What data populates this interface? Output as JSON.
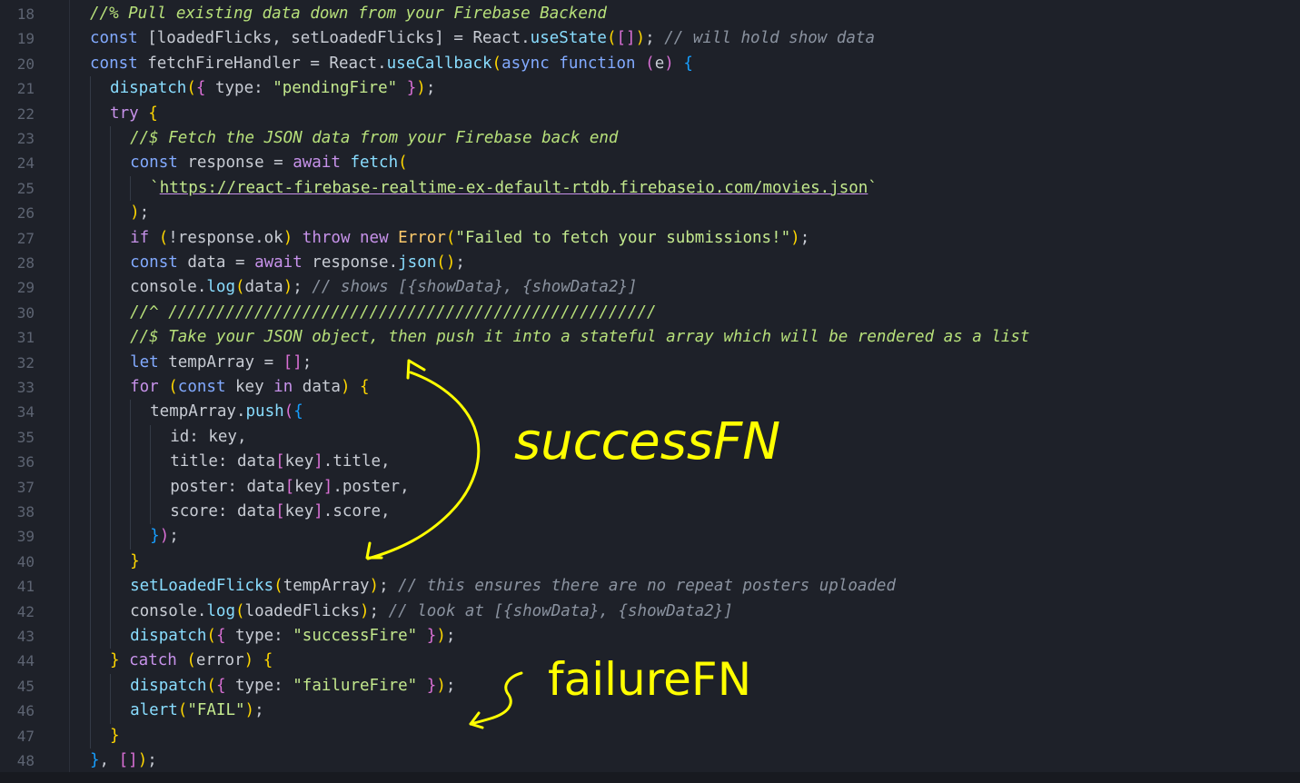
{
  "editor": {
    "first_line_number": 18,
    "lines": [
      {
        "n": "18",
        "indent": 0,
        "tokens": [
          [
            "//% Pull existing data down from your Firebase Backend",
            "hl"
          ]
        ]
      },
      {
        "n": "19",
        "indent": 0,
        "tokens": [
          [
            "const",
            "keyword"
          ],
          [
            " [loadedFlicks, setLoadedFlicks] = React.",
            ""
          ],
          [
            "useState",
            "func"
          ],
          [
            "(",
            "paren"
          ],
          [
            "[]",
            "bracket"
          ],
          [
            ")",
            "paren"
          ],
          [
            "; ",
            ""
          ],
          [
            "// will hold show data",
            "comment"
          ]
        ]
      },
      {
        "n": "20",
        "indent": 0,
        "tokens": [
          [
            "const",
            "keyword"
          ],
          [
            " fetchFireHandler = React.",
            ""
          ],
          [
            "useCallback",
            "func"
          ],
          [
            "(",
            "paren"
          ],
          [
            "async function",
            "keyword"
          ],
          [
            " ",
            ""
          ],
          [
            "(",
            "bracket"
          ],
          [
            "e",
            ""
          ],
          [
            ")",
            "bracket"
          ],
          [
            " ",
            ""
          ],
          [
            "{",
            "brace"
          ]
        ]
      },
      {
        "n": "21",
        "indent": 1,
        "tokens": [
          [
            "dispatch",
            "func"
          ],
          [
            "(",
            "paren"
          ],
          [
            "{",
            "bracket"
          ],
          [
            " type: ",
            ""
          ],
          [
            "\"pendingFire\"",
            "string"
          ],
          [
            " ",
            ""
          ],
          [
            "}",
            "bracket"
          ],
          [
            ")",
            "paren"
          ],
          [
            ";",
            ""
          ]
        ]
      },
      {
        "n": "22",
        "indent": 1,
        "tokens": [
          [
            "try",
            "control"
          ],
          [
            " ",
            ""
          ],
          [
            "{",
            "paren"
          ]
        ]
      },
      {
        "n": "23",
        "indent": 2,
        "tokens": [
          [
            "//$ Fetch the JSON data from your Firebase back end",
            "hl"
          ]
        ]
      },
      {
        "n": "24",
        "indent": 2,
        "tokens": [
          [
            "const",
            "keyword"
          ],
          [
            " response = ",
            ""
          ],
          [
            "await",
            "control"
          ],
          [
            " ",
            ""
          ],
          [
            "fetch",
            "func"
          ],
          [
            "(",
            "paren"
          ]
        ]
      },
      {
        "n": "25",
        "indent": 3,
        "tokens": [
          [
            "`",
            "string"
          ],
          [
            "https://react-firebase-realtime-ex-default-rtdb.firebaseio.com/movies.json",
            "url"
          ],
          [
            "`",
            "string"
          ]
        ]
      },
      {
        "n": "26",
        "indent": 2,
        "tokens": [
          [
            ")",
            "paren"
          ],
          [
            ";",
            ""
          ]
        ]
      },
      {
        "n": "27",
        "indent": 2,
        "tokens": [
          [
            "if",
            "control"
          ],
          [
            " ",
            ""
          ],
          [
            "(",
            "paren"
          ],
          [
            "!response.ok",
            ""
          ],
          [
            ")",
            "paren"
          ],
          [
            " ",
            ""
          ],
          [
            "throw new",
            "control"
          ],
          [
            " ",
            ""
          ],
          [
            "Error",
            "class"
          ],
          [
            "(",
            "paren"
          ],
          [
            "\"Failed to fetch your submissions!\"",
            "string"
          ],
          [
            ")",
            "paren"
          ],
          [
            ";",
            ""
          ]
        ]
      },
      {
        "n": "28",
        "indent": 2,
        "tokens": [
          [
            "const",
            "keyword"
          ],
          [
            " data = ",
            ""
          ],
          [
            "await",
            "control"
          ],
          [
            " response.",
            ""
          ],
          [
            "json",
            "func"
          ],
          [
            "()",
            "paren"
          ],
          [
            ";",
            ""
          ]
        ]
      },
      {
        "n": "29",
        "indent": 2,
        "tokens": [
          [
            "console.",
            ""
          ],
          [
            "log",
            "func"
          ],
          [
            "(",
            "paren"
          ],
          [
            "data",
            ""
          ],
          [
            ")",
            "paren"
          ],
          [
            "; ",
            ""
          ],
          [
            "// shows [{showData}, {showData2}]",
            "comment"
          ]
        ]
      },
      {
        "n": "30",
        "indent": 2,
        "tokens": [
          [
            "//^ ///////////////////////////////////////////////////",
            "hl"
          ]
        ]
      },
      {
        "n": "31",
        "indent": 2,
        "tokens": [
          [
            "//$ Take your JSON object, then push it into a stateful array which will be rendered as a list",
            "hl"
          ]
        ]
      },
      {
        "n": "32",
        "indent": 2,
        "tokens": [
          [
            "let",
            "keyword"
          ],
          [
            " tempArray = ",
            ""
          ],
          [
            "[]",
            "bracket"
          ],
          [
            ";",
            ""
          ]
        ]
      },
      {
        "n": "33",
        "indent": 2,
        "tokens": [
          [
            "for",
            "control"
          ],
          [
            " ",
            ""
          ],
          [
            "(",
            "paren"
          ],
          [
            "const",
            "keyword"
          ],
          [
            " key ",
            ""
          ],
          [
            "in",
            "control"
          ],
          [
            " data",
            ""
          ],
          [
            ")",
            "paren"
          ],
          [
            " ",
            ""
          ],
          [
            "{",
            "paren"
          ]
        ]
      },
      {
        "n": "34",
        "indent": 3,
        "tokens": [
          [
            "tempArray.",
            ""
          ],
          [
            "push",
            "func"
          ],
          [
            "(",
            "bracket"
          ],
          [
            "{",
            "brace"
          ]
        ]
      },
      {
        "n": "35",
        "indent": 4,
        "tokens": [
          [
            "id",
            "prop"
          ],
          [
            ": key,",
            ""
          ]
        ]
      },
      {
        "n": "36",
        "indent": 4,
        "tokens": [
          [
            "title",
            "prop"
          ],
          [
            ": data",
            ""
          ],
          [
            "[",
            "bracket"
          ],
          [
            "key",
            ""
          ],
          [
            "]",
            "bracket"
          ],
          [
            ".title,",
            ""
          ]
        ]
      },
      {
        "n": "37",
        "indent": 4,
        "tokens": [
          [
            "poster",
            "prop"
          ],
          [
            ": data",
            ""
          ],
          [
            "[",
            "bracket"
          ],
          [
            "key",
            ""
          ],
          [
            "]",
            "bracket"
          ],
          [
            ".poster,",
            ""
          ]
        ]
      },
      {
        "n": "38",
        "indent": 4,
        "tokens": [
          [
            "score",
            "prop"
          ],
          [
            ": data",
            ""
          ],
          [
            "[",
            "bracket"
          ],
          [
            "key",
            ""
          ],
          [
            "]",
            "bracket"
          ],
          [
            ".score,",
            ""
          ]
        ]
      },
      {
        "n": "39",
        "indent": 3,
        "tokens": [
          [
            "}",
            "brace"
          ],
          [
            ")",
            "bracket"
          ],
          [
            ";",
            ""
          ]
        ]
      },
      {
        "n": "40",
        "indent": 2,
        "tokens": [
          [
            "}",
            "paren"
          ]
        ]
      },
      {
        "n": "41",
        "indent": 2,
        "tokens": [
          [
            "setLoadedFlicks",
            "func"
          ],
          [
            "(",
            "paren"
          ],
          [
            "tempArray",
            ""
          ],
          [
            ")",
            "paren"
          ],
          [
            "; ",
            ""
          ],
          [
            "// this ensures there are no repeat posters uploaded",
            "comment"
          ]
        ]
      },
      {
        "n": "42",
        "indent": 2,
        "tokens": [
          [
            "console.",
            ""
          ],
          [
            "log",
            "func"
          ],
          [
            "(",
            "paren"
          ],
          [
            "loadedFlicks",
            ""
          ],
          [
            ")",
            "paren"
          ],
          [
            "; ",
            ""
          ],
          [
            "// look at [{showData}, {showData2}]",
            "comment"
          ]
        ]
      },
      {
        "n": "43",
        "indent": 2,
        "tokens": [
          [
            "dispatch",
            "func"
          ],
          [
            "(",
            "paren"
          ],
          [
            "{",
            "bracket"
          ],
          [
            " type: ",
            ""
          ],
          [
            "\"successFire\"",
            "string"
          ],
          [
            " ",
            ""
          ],
          [
            "}",
            "bracket"
          ],
          [
            ")",
            "paren"
          ],
          [
            ";",
            ""
          ]
        ]
      },
      {
        "n": "44",
        "indent": 1,
        "tokens": [
          [
            "}",
            "paren"
          ],
          [
            " ",
            ""
          ],
          [
            "catch",
            "control"
          ],
          [
            " ",
            ""
          ],
          [
            "(",
            "paren"
          ],
          [
            "error",
            ""
          ],
          [
            ")",
            "paren"
          ],
          [
            " ",
            ""
          ],
          [
            "{",
            "paren"
          ]
        ]
      },
      {
        "n": "45",
        "indent": 2,
        "tokens": [
          [
            "dispatch",
            "func"
          ],
          [
            "(",
            "paren"
          ],
          [
            "{",
            "bracket"
          ],
          [
            " type: ",
            ""
          ],
          [
            "\"failureFire\"",
            "string"
          ],
          [
            " ",
            ""
          ],
          [
            "}",
            "bracket"
          ],
          [
            ")",
            "paren"
          ],
          [
            ";",
            ""
          ]
        ]
      },
      {
        "n": "46",
        "indent": 2,
        "tokens": [
          [
            "alert",
            "func"
          ],
          [
            "(",
            "paren"
          ],
          [
            "\"FAIL\"",
            "string"
          ],
          [
            ")",
            "paren"
          ],
          [
            ";",
            ""
          ]
        ]
      },
      {
        "n": "47",
        "indent": 1,
        "tokens": [
          [
            "}",
            "paren"
          ]
        ]
      },
      {
        "n": "48",
        "indent": 0,
        "tokens": [
          [
            "}",
            "brace"
          ],
          [
            ", ",
            ""
          ],
          [
            "[]",
            "bracket"
          ],
          [
            ")",
            "paren"
          ],
          [
            ";",
            ""
          ]
        ]
      }
    ]
  },
  "annotations": {
    "success_label": "successFN",
    "failure_label": "failureFN",
    "ink_color": "#ffff00"
  }
}
